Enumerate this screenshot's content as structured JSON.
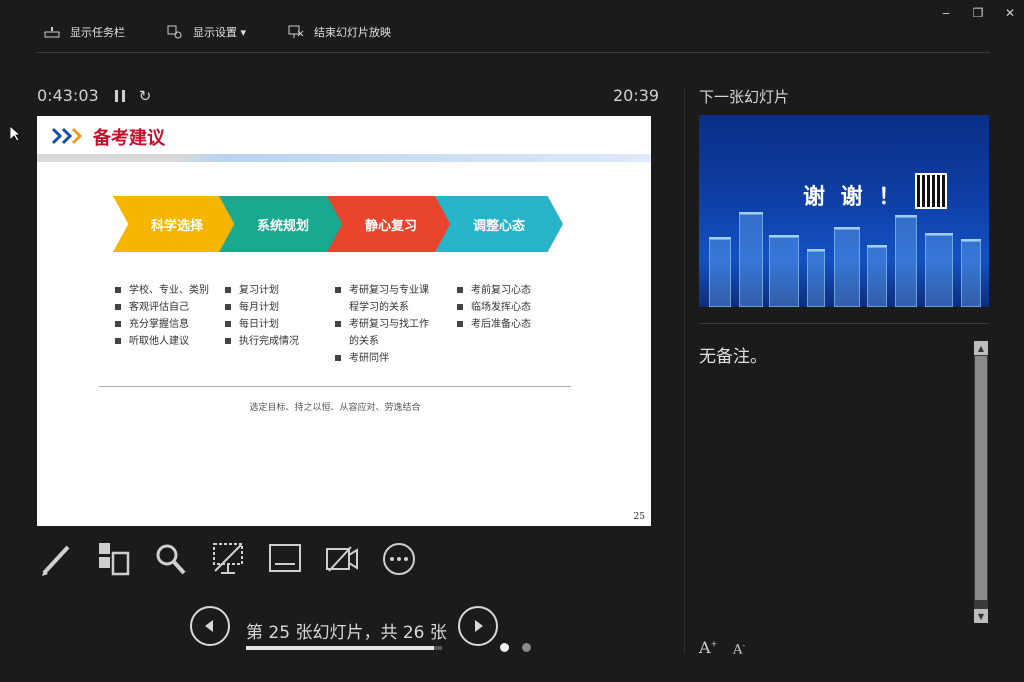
{
  "window": {
    "minimize": "‒",
    "restore": "❐",
    "close": "✕"
  },
  "toolbar": {
    "taskbar_label": "显示任务栏",
    "display_settings_label": "显示设置 ▾",
    "end_show_label": "结束幻灯片放映"
  },
  "timer": {
    "elapsed": "0:43:03",
    "clock": "20:39"
  },
  "slide": {
    "title": "备考建议",
    "steps": [
      "科学选择",
      "系统规划",
      "静心复习",
      "调整心态"
    ],
    "step_colors": [
      "#f7b500",
      "#1aa88e",
      "#e8452c",
      "#27b3c8"
    ],
    "columns": [
      {
        "items": [
          [
            "学校、专业、类别"
          ],
          [
            "客观评估自己"
          ],
          [
            "充分掌握信息"
          ],
          [
            "听取他人建议"
          ]
        ]
      },
      {
        "items": [
          [
            "复习计划"
          ],
          [
            "每月计划"
          ],
          [
            "每日计划"
          ],
          [
            "执行完成情况"
          ]
        ]
      },
      {
        "items": [
          [
            "考研复习与专业课",
            "程学习的关系"
          ],
          [
            "考研复习与找工作",
            "的关系"
          ],
          [
            "考研同伴"
          ]
        ]
      },
      {
        "items": [
          [
            "考前复习心态"
          ],
          [
            "临场发挥心态"
          ],
          [
            "考后准备心态"
          ]
        ]
      }
    ],
    "footer": "选定目标、持之以恒、从容应对、劳逸结合",
    "page_number": "25"
  },
  "tools": [
    "pen-icon",
    "see-all-slides-icon",
    "zoom-icon",
    "black-screen-icon",
    "subtitles-icon",
    "camera-icon",
    "more-options-icon"
  ],
  "navigation": {
    "slide_counter": "第 25 张幻灯片，共 26 张",
    "progress": 0.96
  },
  "next_slide": {
    "label": "下一张幻灯片",
    "thumb_text": "谢 谢 ！"
  },
  "notes": {
    "text": "无备注。"
  },
  "font_controls": {
    "increase": "A",
    "decrease": "A"
  },
  "colors": {
    "background": "#1b1b1b",
    "accent_title": "#c8102e"
  }
}
